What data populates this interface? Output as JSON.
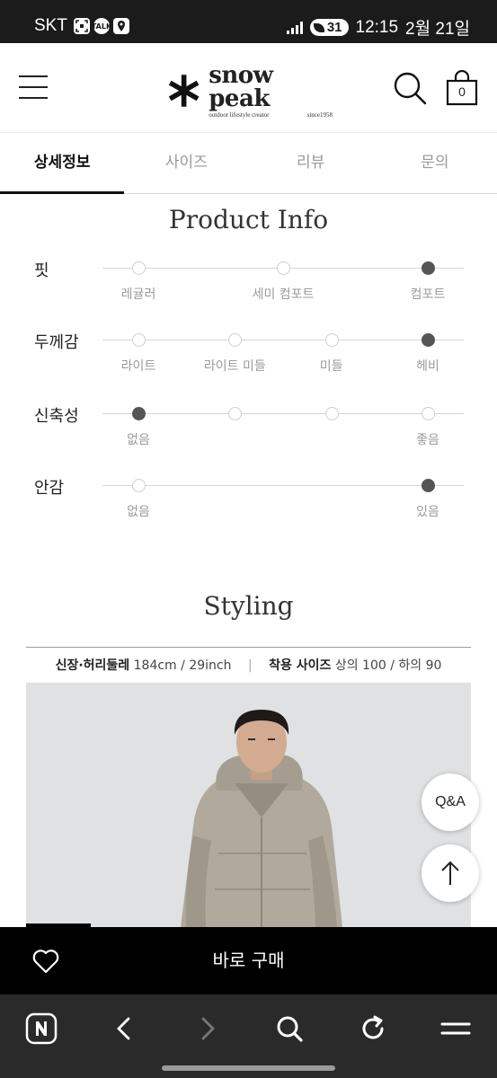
{
  "status_bar": {
    "carrier": "SKT",
    "notification_icons": [
      "screen-capture-icon",
      "talk-icon",
      "map-pin-icon"
    ],
    "talk_label": "TALK",
    "battery": "31",
    "time": "12:15",
    "date": "2월 21일"
  },
  "header": {
    "logo_name": "snow peak",
    "logo_tagline": "outdoor lifestyle creator",
    "logo_since": "since1958",
    "cart_count": "0"
  },
  "tabs": [
    {
      "label": "상세정보",
      "active": true
    },
    {
      "label": "사이즈",
      "active": false
    },
    {
      "label": "리뷰",
      "active": false
    },
    {
      "label": "문의",
      "active": false
    }
  ],
  "product_info": {
    "title": "Product Info",
    "attributes": [
      {
        "name": "핏",
        "steps": 3,
        "selected_index": 2,
        "labels": [
          {
            "index": 0,
            "text": "레귤러"
          },
          {
            "index": 1,
            "text": "세미 컴포트"
          },
          {
            "index": 2,
            "text": "컴포트"
          }
        ]
      },
      {
        "name": "두께감",
        "steps": 4,
        "selected_index": 3,
        "labels": [
          {
            "index": 0,
            "text": "라이트"
          },
          {
            "index": 1,
            "text": "라이트 미들"
          },
          {
            "index": 2,
            "text": "미들"
          },
          {
            "index": 3,
            "text": "헤비"
          }
        ]
      },
      {
        "name": "신축성",
        "steps": 4,
        "selected_index": 0,
        "labels": [
          {
            "index": 0,
            "text": "없음"
          },
          {
            "index": 3,
            "text": "좋음"
          }
        ]
      },
      {
        "name": "안감",
        "steps": 2,
        "selected_index": 1,
        "labels": [
          {
            "index": 0,
            "text": "없음"
          },
          {
            "index": 1,
            "text": "있음"
          }
        ]
      }
    ]
  },
  "styling": {
    "title": "Styling",
    "height_waist_label": "신장·허리둘레",
    "height_waist_value": "184cm / 29inch",
    "size_label": "착용 사이즈",
    "size_value": "상의 100 / 하의 90"
  },
  "floating": {
    "qa_label": "Q&A",
    "top_icon": "arrow-up-icon"
  },
  "buy_bar": {
    "wish_icon": "heart-icon",
    "buy_label": "바로 구매"
  },
  "browser_bar": {
    "icons": [
      "naver-icon",
      "back-icon",
      "forward-icon",
      "search-icon",
      "refresh-icon",
      "menu-icon"
    ]
  },
  "colors": {
    "accent": "#111111",
    "dot_selected": "#555555",
    "dot_empty_border": "#cfcfcf",
    "buy_bar_bg": "#000000",
    "status_bar_bg": "#1b1b1b",
    "browser_bar_bg": "#2a2a2a"
  }
}
